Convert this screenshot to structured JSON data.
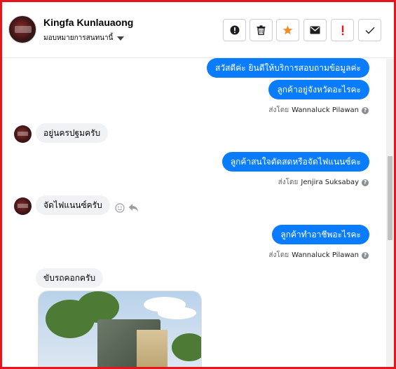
{
  "header": {
    "contact_name": "Kingfa Kunlauaong",
    "assign_label": "มอบหมายการสนทนานี้",
    "buttons": [
      {
        "name": "alert-button",
        "icon": "exclamation-circle-icon"
      },
      {
        "name": "delete-button",
        "icon": "trash-icon"
      },
      {
        "name": "star-button",
        "icon": "star-icon",
        "color": "#f28c28"
      },
      {
        "name": "email-button",
        "icon": "envelope-icon"
      },
      {
        "name": "spam-button",
        "icon": "exclamation-icon",
        "color": "#e4161b"
      },
      {
        "name": "done-button",
        "icon": "check-icon"
      }
    ]
  },
  "messages": [
    {
      "dir": "out",
      "text": "สวัสดีค่ะ  ยินดีให้บริการสอบถามข้อมูลค่ะ"
    },
    {
      "dir": "out",
      "text": "ลูกค้าอยู่จังหวัดอะไรคะ"
    },
    {
      "dir": "sent_by",
      "prefix": "ส่งโดย",
      "agent": "Wannaluck Pilawan"
    },
    {
      "dir": "in",
      "text": "อยู่นครปฐมครับ"
    },
    {
      "dir": "out",
      "text": "ลูกค้าสนใจตัดสดหรือจัดไฟแนนซ์คะ"
    },
    {
      "dir": "sent_by",
      "prefix": "ส่งโดย",
      "agent": "Jenjira Suksabay"
    },
    {
      "dir": "in",
      "text": "จัดไฟแนนซ์ครับ"
    },
    {
      "dir": "out",
      "text": "ลูกค้าทำอาชีพอะไรคะ"
    },
    {
      "dir": "sent_by",
      "prefix": "ส่งโดย",
      "agent": "Wannaluck Pilawan"
    },
    {
      "dir": "in",
      "text": "ขับรถคอกครับ"
    }
  ],
  "colors": {
    "outgoing_bubble": "#0a7cff",
    "incoming_bubble": "#f0f2f5",
    "frame": "#e4161b"
  },
  "icons": [
    "smile-icon",
    "reply-icon",
    "help-icon"
  ]
}
